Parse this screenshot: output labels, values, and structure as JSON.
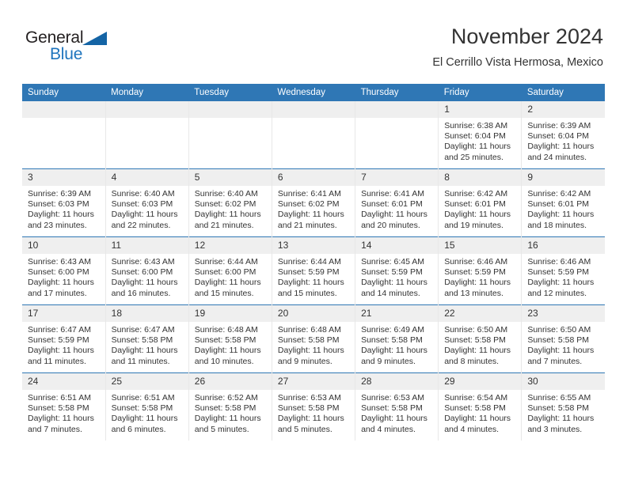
{
  "brand": {
    "name_part1": "General",
    "name_part2": "Blue",
    "triangle_color": "#1464a5",
    "blue_color": "#1e74bd"
  },
  "header": {
    "month_title": "November 2024",
    "location": "El Cerrillo Vista Hermosa, Mexico"
  },
  "theme": {
    "header_blue": "#2f77b5",
    "daynum_gray": "#efefef",
    "text": "#333333"
  },
  "weekday_headers": [
    "Sunday",
    "Monday",
    "Tuesday",
    "Wednesday",
    "Thursday",
    "Friday",
    "Saturday"
  ],
  "weeks": [
    [
      {
        "day": "",
        "empty": true
      },
      {
        "day": "",
        "empty": true
      },
      {
        "day": "",
        "empty": true
      },
      {
        "day": "",
        "empty": true
      },
      {
        "day": "",
        "empty": true
      },
      {
        "day": "1",
        "sunrise": "Sunrise: 6:38 AM",
        "sunset": "Sunset: 6:04 PM",
        "daylight": "Daylight: 11 hours and 25 minutes."
      },
      {
        "day": "2",
        "sunrise": "Sunrise: 6:39 AM",
        "sunset": "Sunset: 6:04 PM",
        "daylight": "Daylight: 11 hours and 24 minutes."
      }
    ],
    [
      {
        "day": "3",
        "sunrise": "Sunrise: 6:39 AM",
        "sunset": "Sunset: 6:03 PM",
        "daylight": "Daylight: 11 hours and 23 minutes."
      },
      {
        "day": "4",
        "sunrise": "Sunrise: 6:40 AM",
        "sunset": "Sunset: 6:03 PM",
        "daylight": "Daylight: 11 hours and 22 minutes."
      },
      {
        "day": "5",
        "sunrise": "Sunrise: 6:40 AM",
        "sunset": "Sunset: 6:02 PM",
        "daylight": "Daylight: 11 hours and 21 minutes."
      },
      {
        "day": "6",
        "sunrise": "Sunrise: 6:41 AM",
        "sunset": "Sunset: 6:02 PM",
        "daylight": "Daylight: 11 hours and 21 minutes."
      },
      {
        "day": "7",
        "sunrise": "Sunrise: 6:41 AM",
        "sunset": "Sunset: 6:01 PM",
        "daylight": "Daylight: 11 hours and 20 minutes."
      },
      {
        "day": "8",
        "sunrise": "Sunrise: 6:42 AM",
        "sunset": "Sunset: 6:01 PM",
        "daylight": "Daylight: 11 hours and 19 minutes."
      },
      {
        "day": "9",
        "sunrise": "Sunrise: 6:42 AM",
        "sunset": "Sunset: 6:01 PM",
        "daylight": "Daylight: 11 hours and 18 minutes."
      }
    ],
    [
      {
        "day": "10",
        "sunrise": "Sunrise: 6:43 AM",
        "sunset": "Sunset: 6:00 PM",
        "daylight": "Daylight: 11 hours and 17 minutes."
      },
      {
        "day": "11",
        "sunrise": "Sunrise: 6:43 AM",
        "sunset": "Sunset: 6:00 PM",
        "daylight": "Daylight: 11 hours and 16 minutes."
      },
      {
        "day": "12",
        "sunrise": "Sunrise: 6:44 AM",
        "sunset": "Sunset: 6:00 PM",
        "daylight": "Daylight: 11 hours and 15 minutes."
      },
      {
        "day": "13",
        "sunrise": "Sunrise: 6:44 AM",
        "sunset": "Sunset: 5:59 PM",
        "daylight": "Daylight: 11 hours and 15 minutes."
      },
      {
        "day": "14",
        "sunrise": "Sunrise: 6:45 AM",
        "sunset": "Sunset: 5:59 PM",
        "daylight": "Daylight: 11 hours and 14 minutes."
      },
      {
        "day": "15",
        "sunrise": "Sunrise: 6:46 AM",
        "sunset": "Sunset: 5:59 PM",
        "daylight": "Daylight: 11 hours and 13 minutes."
      },
      {
        "day": "16",
        "sunrise": "Sunrise: 6:46 AM",
        "sunset": "Sunset: 5:59 PM",
        "daylight": "Daylight: 11 hours and 12 minutes."
      }
    ],
    [
      {
        "day": "17",
        "sunrise": "Sunrise: 6:47 AM",
        "sunset": "Sunset: 5:59 PM",
        "daylight": "Daylight: 11 hours and 11 minutes."
      },
      {
        "day": "18",
        "sunrise": "Sunrise: 6:47 AM",
        "sunset": "Sunset: 5:58 PM",
        "daylight": "Daylight: 11 hours and 11 minutes."
      },
      {
        "day": "19",
        "sunrise": "Sunrise: 6:48 AM",
        "sunset": "Sunset: 5:58 PM",
        "daylight": "Daylight: 11 hours and 10 minutes."
      },
      {
        "day": "20",
        "sunrise": "Sunrise: 6:48 AM",
        "sunset": "Sunset: 5:58 PM",
        "daylight": "Daylight: 11 hours and 9 minutes."
      },
      {
        "day": "21",
        "sunrise": "Sunrise: 6:49 AM",
        "sunset": "Sunset: 5:58 PM",
        "daylight": "Daylight: 11 hours and 9 minutes."
      },
      {
        "day": "22",
        "sunrise": "Sunrise: 6:50 AM",
        "sunset": "Sunset: 5:58 PM",
        "daylight": "Daylight: 11 hours and 8 minutes."
      },
      {
        "day": "23",
        "sunrise": "Sunrise: 6:50 AM",
        "sunset": "Sunset: 5:58 PM",
        "daylight": "Daylight: 11 hours and 7 minutes."
      }
    ],
    [
      {
        "day": "24",
        "sunrise": "Sunrise: 6:51 AM",
        "sunset": "Sunset: 5:58 PM",
        "daylight": "Daylight: 11 hours and 7 minutes."
      },
      {
        "day": "25",
        "sunrise": "Sunrise: 6:51 AM",
        "sunset": "Sunset: 5:58 PM",
        "daylight": "Daylight: 11 hours and 6 minutes."
      },
      {
        "day": "26",
        "sunrise": "Sunrise: 6:52 AM",
        "sunset": "Sunset: 5:58 PM",
        "daylight": "Daylight: 11 hours and 5 minutes."
      },
      {
        "day": "27",
        "sunrise": "Sunrise: 6:53 AM",
        "sunset": "Sunset: 5:58 PM",
        "daylight": "Daylight: 11 hours and 5 minutes."
      },
      {
        "day": "28",
        "sunrise": "Sunrise: 6:53 AM",
        "sunset": "Sunset: 5:58 PM",
        "daylight": "Daylight: 11 hours and 4 minutes."
      },
      {
        "day": "29",
        "sunrise": "Sunrise: 6:54 AM",
        "sunset": "Sunset: 5:58 PM",
        "daylight": "Daylight: 11 hours and 4 minutes."
      },
      {
        "day": "30",
        "sunrise": "Sunrise: 6:55 AM",
        "sunset": "Sunset: 5:58 PM",
        "daylight": "Daylight: 11 hours and 3 minutes."
      }
    ]
  ]
}
